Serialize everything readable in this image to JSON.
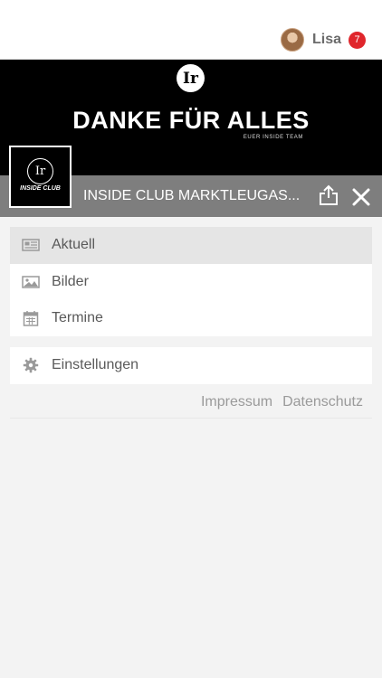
{
  "user": {
    "name": "Lisa",
    "notification_count": "7"
  },
  "banner": {
    "logo_glyph": "Ir",
    "headline": "DANKE FÜR ALLES",
    "subline": "EUER INSIDE TEAM"
  },
  "club": {
    "logo_glyph": "Ir",
    "logo_wordmark": "INSIDE CLUB",
    "title": "INSIDE CLUB MARKTLEUGAS..."
  },
  "menu": {
    "items": [
      {
        "label": "Aktuell",
        "icon": "newspaper-icon",
        "active": true
      },
      {
        "label": "Bilder",
        "icon": "image-icon",
        "active": false
      },
      {
        "label": "Termine",
        "icon": "calendar-icon",
        "active": false
      }
    ],
    "settings_label": "Einstellungen"
  },
  "footer": {
    "impressum": "Impressum",
    "datenschutz": "Datenschutz"
  },
  "colors": {
    "accent_badge": "#e0262c",
    "titlebar": "#7e7e7e",
    "active_item": "#e5e5e5"
  }
}
